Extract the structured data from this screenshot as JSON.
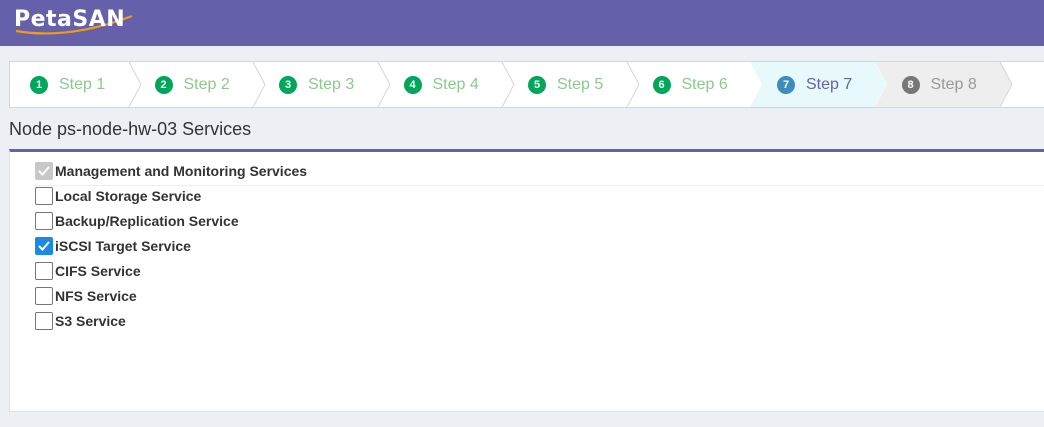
{
  "app": {
    "logo_text": "PetaSAN"
  },
  "wizard": {
    "steps": [
      {
        "num": "1",
        "label": "Step 1",
        "state": "done"
      },
      {
        "num": "2",
        "label": "Step 2",
        "state": "done"
      },
      {
        "num": "3",
        "label": "Step 3",
        "state": "done"
      },
      {
        "num": "4",
        "label": "Step 4",
        "state": "done"
      },
      {
        "num": "5",
        "label": "Step 5",
        "state": "done"
      },
      {
        "num": "6",
        "label": "Step 6",
        "state": "done"
      },
      {
        "num": "7",
        "label": "Step 7",
        "state": "active"
      },
      {
        "num": "8",
        "label": "Step 8",
        "state": "todo"
      }
    ]
  },
  "page": {
    "title": "Node ps-node-hw-03 Services"
  },
  "services": [
    {
      "label": "Management and Monitoring Services",
      "checked": true,
      "disabled": true
    },
    {
      "label": "Local Storage Service",
      "checked": false,
      "disabled": false
    },
    {
      "label": "Backup/Replication Service",
      "checked": false,
      "disabled": false
    },
    {
      "label": "iSCSI Target Service",
      "checked": true,
      "disabled": false
    },
    {
      "label": "CIFS Service",
      "checked": false,
      "disabled": false
    },
    {
      "label": "NFS Service",
      "checked": false,
      "disabled": false
    },
    {
      "label": "S3 Service",
      "checked": false,
      "disabled": false
    }
  ],
  "colors": {
    "brand": "#6560aa",
    "step_done": "#00a65a",
    "step_active": "#3c8dbc",
    "step_todo": "#777777",
    "checkbox_checked": "#1e88e5"
  }
}
